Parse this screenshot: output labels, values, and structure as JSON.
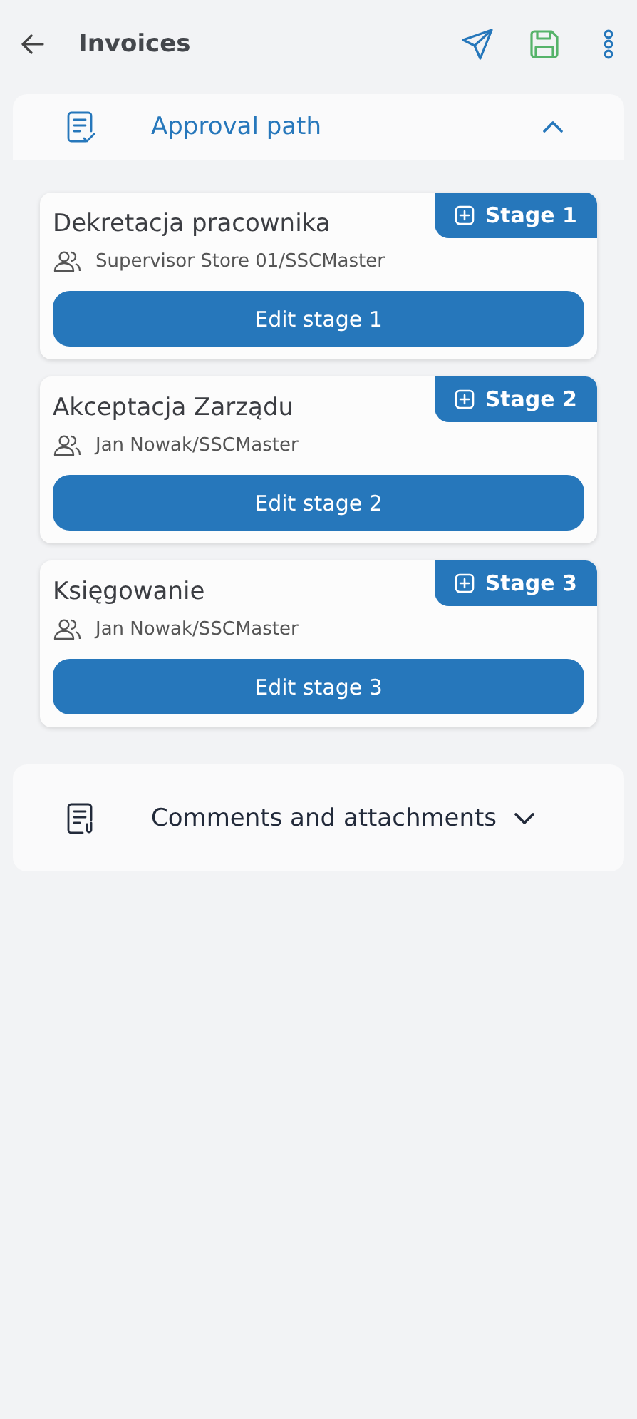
{
  "header": {
    "title": "Invoices"
  },
  "sections": [
    {
      "kind": "approval",
      "title": "Approval path",
      "expanded": true,
      "stages": [
        {
          "name": "Dekretacja pracownika",
          "badge": "Stage 1",
          "assignee": "Supervisor Store 01/SSCMaster",
          "button": "Edit stage 1"
        },
        {
          "name": "Akceptacja Zarządu",
          "badge": "Stage 2",
          "assignee": "Jan Nowak/SSCMaster",
          "button": "Edit stage 2"
        },
        {
          "name": "Księgowanie",
          "badge": "Stage 3",
          "assignee": "Jan Nowak/SSCMaster",
          "button": "Edit stage 3"
        }
      ]
    },
    {
      "kind": "comments",
      "title": "Comments and attachments",
      "expanded": false
    }
  ]
}
